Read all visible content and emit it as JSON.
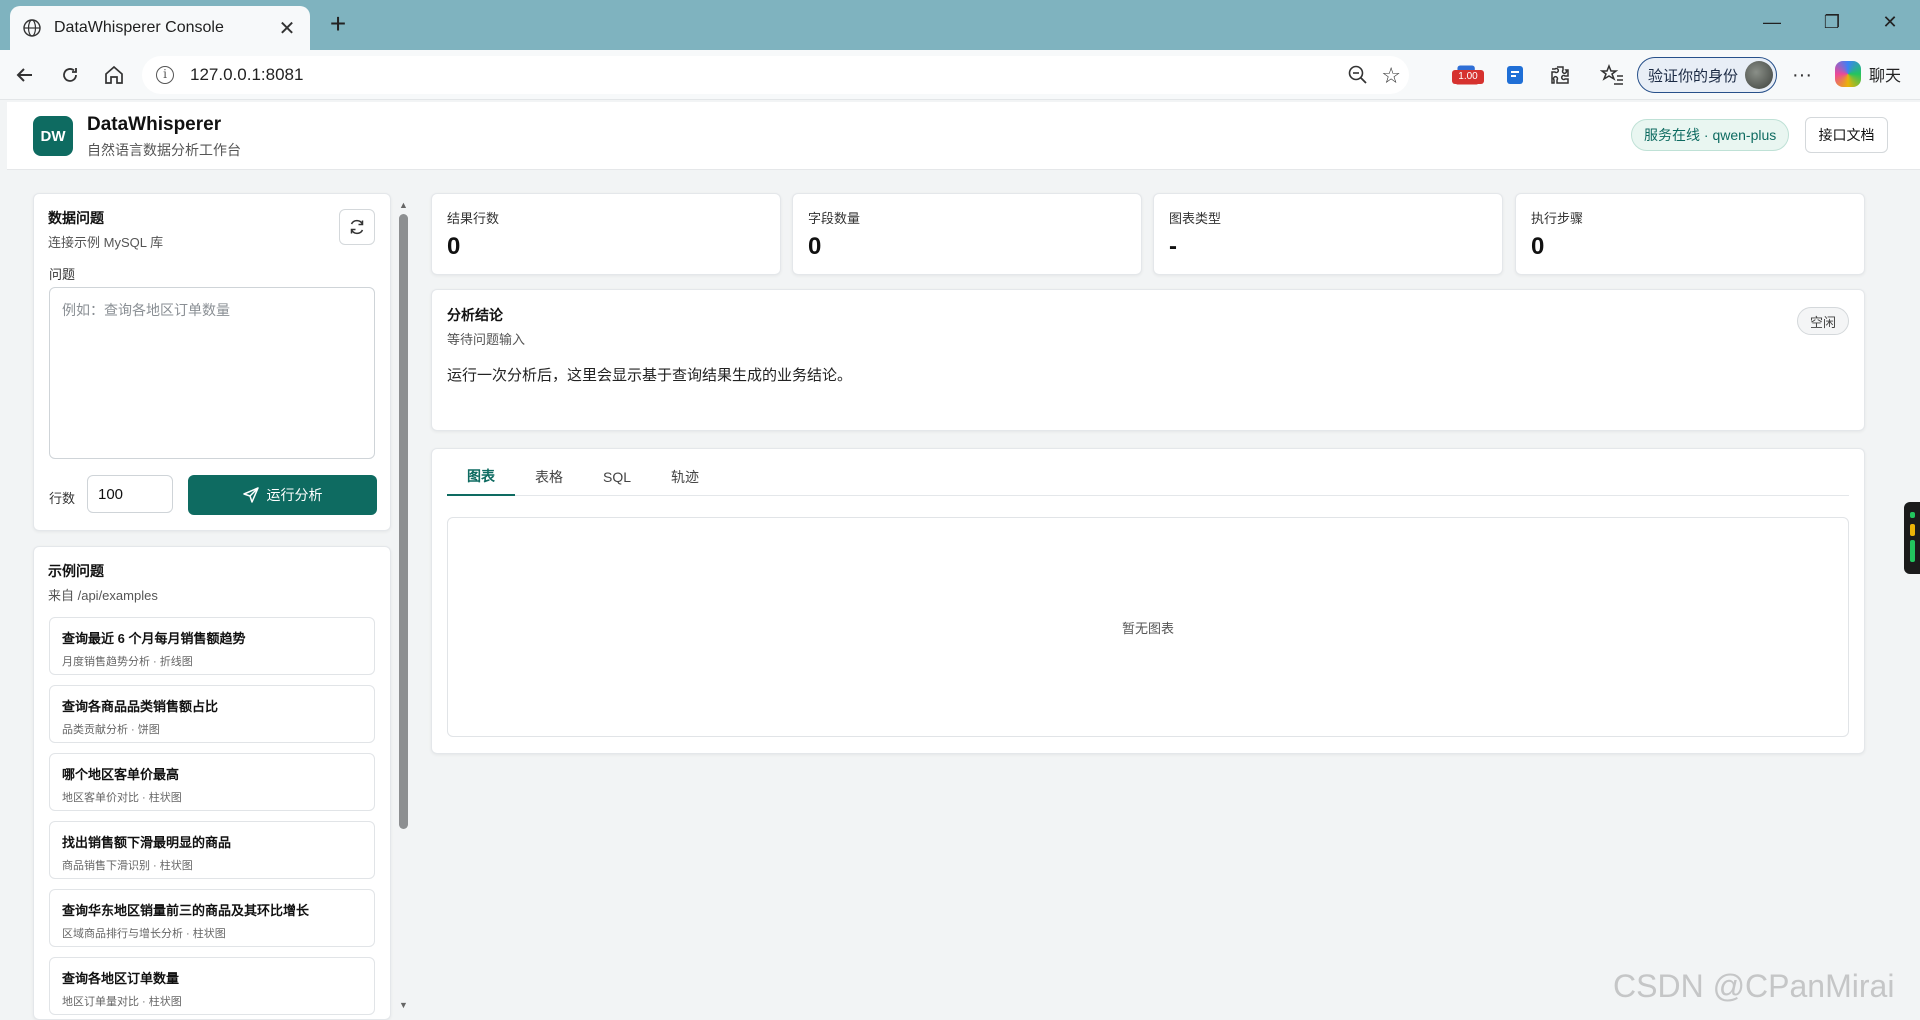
{
  "browser": {
    "tab_title": "DataWhisperer Console",
    "url": "127.0.0.1:8081",
    "verify_label": "验证你的身份",
    "chat_label": "聊天",
    "extension_badge": "1.00"
  },
  "header": {
    "logo_text": "DW",
    "title": "DataWhisperer",
    "subtitle": "自然语言数据分析工作台",
    "status": "服务在线 · qwen-plus",
    "docs_button": "接口文档"
  },
  "question_card": {
    "title": "数据问题",
    "subtitle": "连接示例 MySQL 库",
    "question_label": "问题",
    "question_placeholder": "例如：查询各地区订单数量",
    "question_value": "",
    "rows_label": "行数",
    "rows_value": "100",
    "run_button": "运行分析"
  },
  "examples_card": {
    "title": "示例问题",
    "subtitle": "来自 /api/examples",
    "items": [
      {
        "title": "查询最近 6 个月每月销售额趋势",
        "sub": "月度销售趋势分析 · 折线图"
      },
      {
        "title": "查询各商品品类销售额占比",
        "sub": "品类贡献分析 · 饼图"
      },
      {
        "title": "哪个地区客单价最高",
        "sub": "地区客单价对比 · 柱状图"
      },
      {
        "title": "找出销售额下滑最明显的商品",
        "sub": "商品销售下滑识别 · 柱状图"
      },
      {
        "title": "查询华东地区销量前三的商品及其环比增长",
        "sub": "区域商品排行与增长分析 · 柱状图"
      },
      {
        "title": "查询各地区订单数量",
        "sub": "地区订单量对比 · 柱状图"
      }
    ]
  },
  "metrics": [
    {
      "label": "结果行数",
      "value": "0"
    },
    {
      "label": "字段数量",
      "value": "0"
    },
    {
      "label": "图表类型",
      "value": "-"
    },
    {
      "label": "执行步骤",
      "value": "0"
    }
  ],
  "analysis": {
    "title": "分析结论",
    "subtitle": "等待问题输入",
    "status": "空闲",
    "body": "运行一次分析后，这里会显示基于查询结果生成的业务结论。"
  },
  "result_tabs": {
    "tabs": [
      {
        "label": "图表",
        "active": true
      },
      {
        "label": "表格",
        "active": false
      },
      {
        "label": "SQL",
        "active": false
      },
      {
        "label": "轨迹",
        "active": false
      }
    ],
    "empty_text": "暂无图表"
  },
  "watermark": "CSDN @CPanMirai",
  "colors": {
    "accent": "#0e6b61",
    "tabbar": "#7fb3bf",
    "status_bg": "#e9f6f1"
  }
}
